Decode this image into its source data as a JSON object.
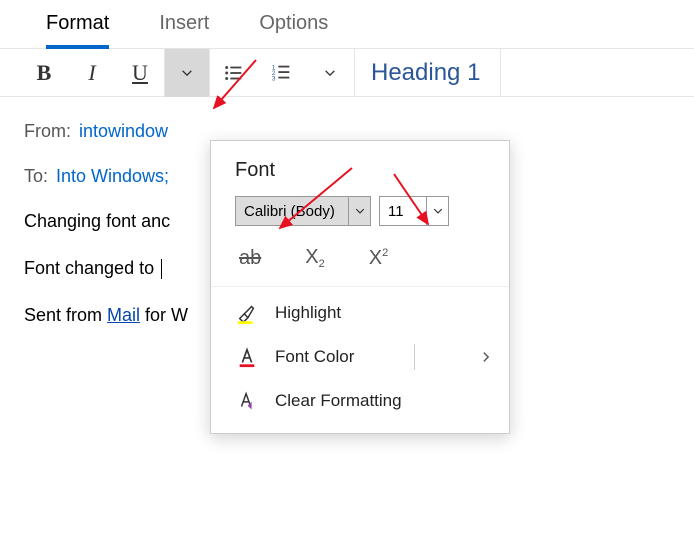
{
  "tabs": {
    "format": "Format",
    "insert": "Insert",
    "options": "Options"
  },
  "toolbar": {
    "bold": "B",
    "italic": "I",
    "underline": "U",
    "heading_style": "Heading 1"
  },
  "compose": {
    "from_label": "From:",
    "from_value": "intowindow",
    "to_label": "To:",
    "to_value": "Into Windows;",
    "subject_line": "Changing font anc",
    "body_line": "Font changed to ",
    "sent_prefix": "Sent from ",
    "sent_link": "Mail",
    "sent_suffix": " for W"
  },
  "popup": {
    "title": "Font",
    "font_name": "Calibri (Body)",
    "font_size": "11",
    "strike_glyph": "ab",
    "sub_base": "X",
    "sub_idx": "2",
    "sup_base": "X",
    "sup_idx": "2",
    "highlight": "Highlight",
    "font_color": "Font Color",
    "clear_format": "Clear Formatting"
  }
}
